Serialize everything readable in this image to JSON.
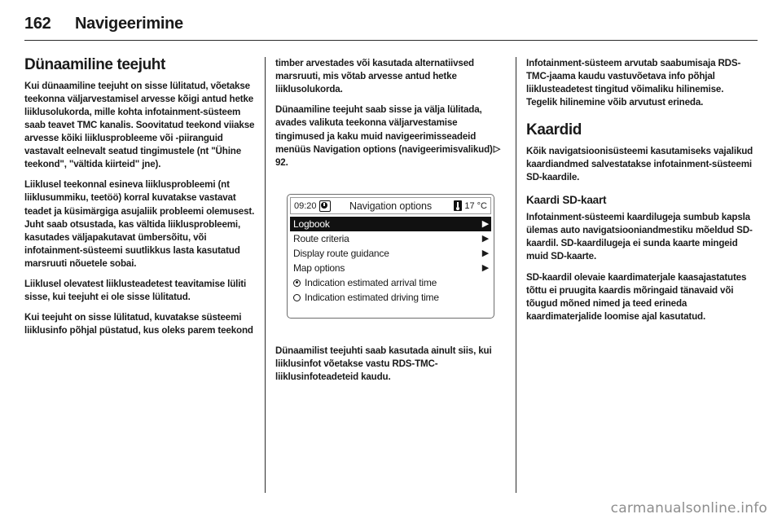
{
  "header": {
    "folio": "162",
    "chapter": "Navigeerimine"
  },
  "columns": {
    "left": {
      "heading": "Dünaamiline teejuht",
      "paragraphs": [
        "Kui dünaamiline teejuht on sisse lülitatud, võetakse teekonna väljarvestamisel arvesse kõigi antud hetke liiklusolukorda, mille kohta infotainment-süsteem saab teavet TMC kanalis. Soovitatud teekond viiakse arvesse kõiki liiklusprobleeme või -piiranguid vastavalt eelnevalt seatud tingimustele (nt \"Ühine teekond\", \"vältida kiirteid\" jne).",
        "Liiklusel teekonnal esineva liiklusprobleemi (nt liiklusummiku, teetöö) korral kuvatakse vastavat teadet ja küsimärgiga asujaliik probleemi olemusest. Juht saab otsustada, kas vältida liiklusprobleemi, kasutades väljapakutavat ümbersõitu, või infotainment-süsteemi suutlikkus lasta kasutatud marsruuti nõuetele sobai.",
        "Liiklusel olevatest liiklusteadetest teavitamise lüliti sisse, kui teejuht ei ole sisse lülitatud.",
        "Kui teejuht on sisse lülitatud, kuvatakse süsteemi liiklusinfo põhjal püstatud, kus oleks parem teekond"
      ]
    },
    "middle": {
      "paragraphs_above": [
        "timber arvestades või kasutada alternatiivsed marsruuti, mis võtab arvesse antud hetke liiklusolukorda.",
        "Dünaamiline teejuht saab sisse ja välja lülitada, avades valikuta teekonna väljarvestamise tingimused ja kaku muid navigeerimisseadeid menüüs Navigation options (navigeerimisvalikud)"
      ],
      "reference_arrow": "▷",
      "reference_page": "92",
      "paragraphs_below": [
        "Dünaamilist teejuhti saab kasutada ainult siis, kui liiklusinfot võetakse vastu RDS-TMC-liiklusinfoteadeteid kaudu."
      ],
      "figure": {
        "status": {
          "time": "09:20",
          "clock_icon": "clock-icon",
          "title": "Navigation options",
          "temp_icon": "thermometer-icon",
          "temperature": "17 °C"
        },
        "menu_items": [
          {
            "label": "Logbook",
            "chevron": "▶",
            "selected": true,
            "type": "submenu"
          },
          {
            "label": "Route criteria",
            "chevron": "▶",
            "selected": false,
            "type": "submenu"
          },
          {
            "label": "Display route guidance",
            "chevron": "▶",
            "selected": false,
            "type": "submenu"
          },
          {
            "label": "Map options",
            "chevron": "▶",
            "selected": false,
            "type": "submenu"
          }
        ],
        "radio_items": [
          {
            "label": "Indication estimated arrival time",
            "checked": true
          },
          {
            "label": "Indication estimated driving time",
            "checked": false
          }
        ]
      }
    },
    "right": {
      "paragraphs_top": [
        "Infotainment-süsteem arvutab saabumisaja RDS-TMC-jaama kaudu vastuvõetava info põhjal liiklusteadetest tingitud võimaliku hilinemise. Tegelik hilinemine võib arvutust erineda."
      ],
      "heading1": "Kaardid",
      "paragraphs_mid": [
        "Kõik navigatsioonisüsteemi kasutamiseks vajalikud kaardiandmed salvestatakse infotainment-süsteemi SD-kaardile."
      ],
      "heading2": "Kaardi SD-kaart",
      "paragraphs_bottom": [
        "Infotainment-süsteemi kaardilugeja sumbub kapsla ülemas auto navigatsiooniandmestiku mõeldud SD-kaardil. SD-kaardilugeja ei sunda kaarte mingeid muid SD-kaarte.",
        "SD-kaardil olevaie kaardimaterjale kaasajastatutes tõttu ei pruugita kaardis mõringaid tänavaid või tõugud mõned nimed ja teed erineda kaardimaterjalide loomise ajal kasutatud."
      ]
    }
  },
  "watermark": "carmanualsonline.info"
}
